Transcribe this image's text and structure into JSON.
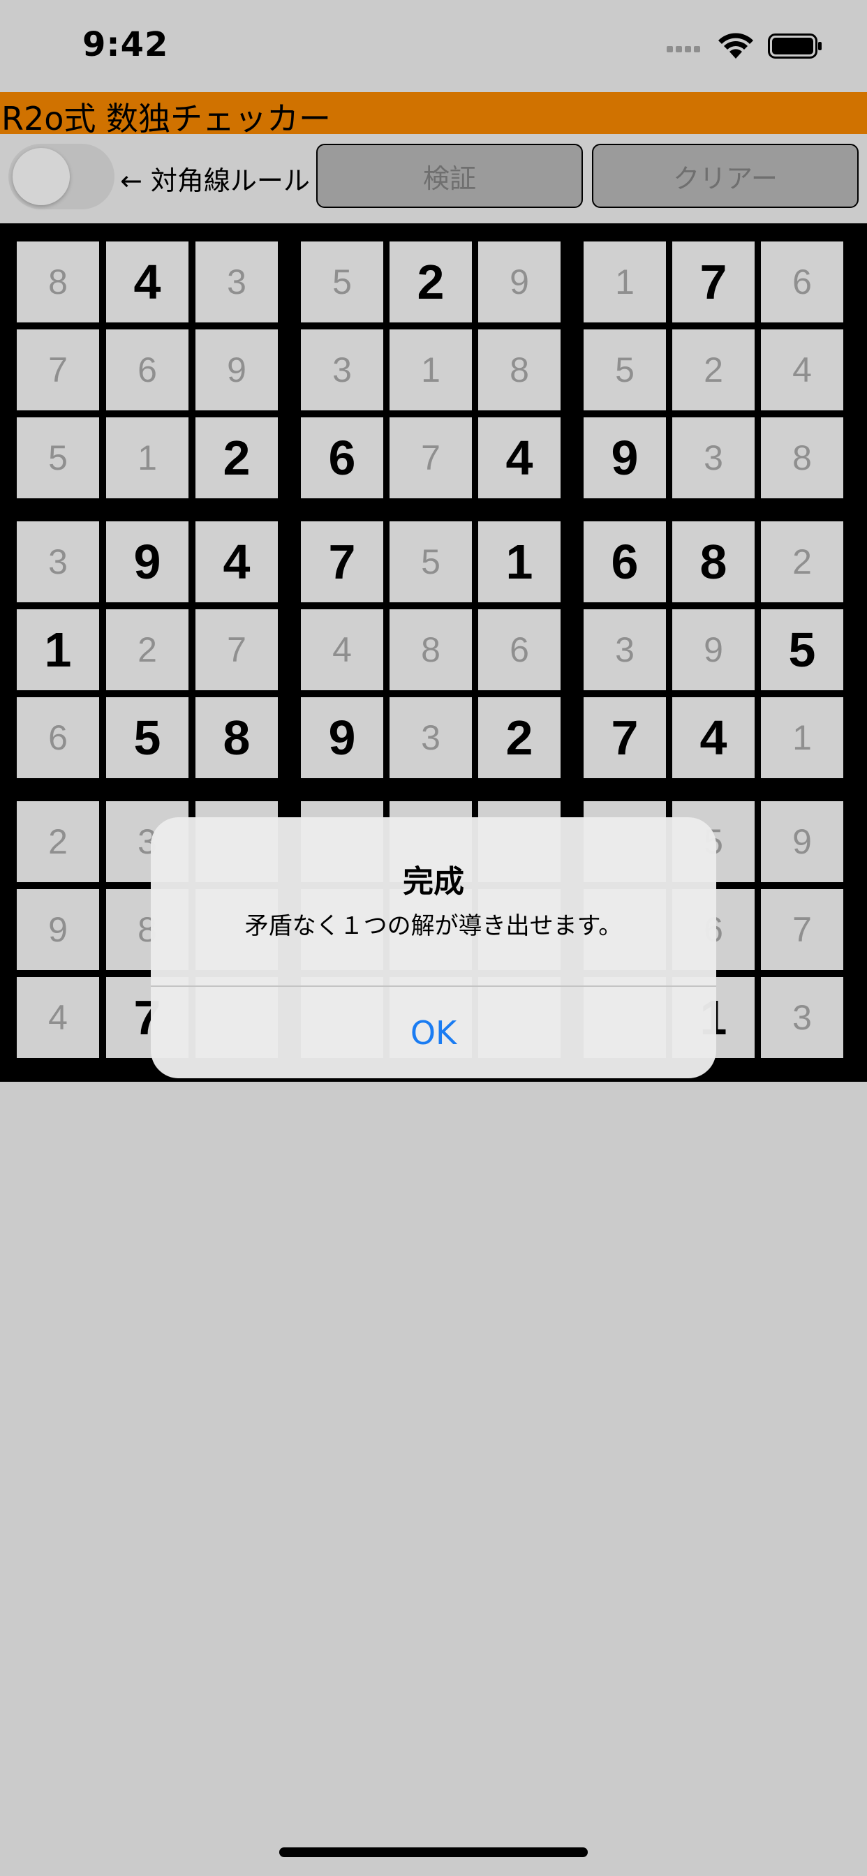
{
  "status": {
    "time": "9:42",
    "icons": [
      "cellular-signal-icon",
      "wifi-icon",
      "battery-icon"
    ]
  },
  "app": {
    "title": "R2o式 数独チェッカー",
    "title_bar_color": "#d07200"
  },
  "toolbar": {
    "diagonal_toggle_on": false,
    "diagonal_label": "← 対角線ルール",
    "verify_label": "検証",
    "clear_label": "クリアー"
  },
  "board": {
    "rows": [
      [
        {
          "v": "8",
          "given": false
        },
        {
          "v": "4",
          "given": true
        },
        {
          "v": "3",
          "given": false
        },
        {
          "v": "5",
          "given": false
        },
        {
          "v": "2",
          "given": true
        },
        {
          "v": "9",
          "given": false
        },
        {
          "v": "1",
          "given": false
        },
        {
          "v": "7",
          "given": true
        },
        {
          "v": "6",
          "given": false
        }
      ],
      [
        {
          "v": "7",
          "given": false
        },
        {
          "v": "6",
          "given": false
        },
        {
          "v": "9",
          "given": false
        },
        {
          "v": "3",
          "given": false
        },
        {
          "v": "1",
          "given": false
        },
        {
          "v": "8",
          "given": false
        },
        {
          "v": "5",
          "given": false
        },
        {
          "v": "2",
          "given": false
        },
        {
          "v": "4",
          "given": false
        }
      ],
      [
        {
          "v": "5",
          "given": false
        },
        {
          "v": "1",
          "given": false
        },
        {
          "v": "2",
          "given": true
        },
        {
          "v": "6",
          "given": true
        },
        {
          "v": "7",
          "given": false
        },
        {
          "v": "4",
          "given": true
        },
        {
          "v": "9",
          "given": true
        },
        {
          "v": "3",
          "given": false
        },
        {
          "v": "8",
          "given": false
        }
      ],
      [
        {
          "v": "3",
          "given": false
        },
        {
          "v": "9",
          "given": true
        },
        {
          "v": "4",
          "given": true
        },
        {
          "v": "7",
          "given": true
        },
        {
          "v": "5",
          "given": false
        },
        {
          "v": "1",
          "given": true
        },
        {
          "v": "6",
          "given": true
        },
        {
          "v": "8",
          "given": true
        },
        {
          "v": "2",
          "given": false
        }
      ],
      [
        {
          "v": "1",
          "given": true
        },
        {
          "v": "2",
          "given": false
        },
        {
          "v": "7",
          "given": false
        },
        {
          "v": "4",
          "given": false
        },
        {
          "v": "8",
          "given": false
        },
        {
          "v": "6",
          "given": false
        },
        {
          "v": "3",
          "given": false
        },
        {
          "v": "9",
          "given": false
        },
        {
          "v": "5",
          "given": true
        }
      ],
      [
        {
          "v": "6",
          "given": false
        },
        {
          "v": "5",
          "given": true
        },
        {
          "v": "8",
          "given": true
        },
        {
          "v": "9",
          "given": true
        },
        {
          "v": "3",
          "given": false
        },
        {
          "v": "2",
          "given": true
        },
        {
          "v": "7",
          "given": true
        },
        {
          "v": "4",
          "given": true
        },
        {
          "v": "1",
          "given": false
        }
      ],
      [
        {
          "v": "2",
          "given": false
        },
        {
          "v": "3",
          "given": false
        },
        {
          "v": "",
          "given": false
        },
        {
          "v": "",
          "given": false
        },
        {
          "v": "",
          "given": false
        },
        {
          "v": "",
          "given": false
        },
        {
          "v": "",
          "given": false
        },
        {
          "v": "5",
          "given": false
        },
        {
          "v": "9",
          "given": false
        }
      ],
      [
        {
          "v": "9",
          "given": false
        },
        {
          "v": "8",
          "given": false
        },
        {
          "v": "",
          "given": false
        },
        {
          "v": "",
          "given": false
        },
        {
          "v": "",
          "given": false
        },
        {
          "v": "",
          "given": false
        },
        {
          "v": "",
          "given": false
        },
        {
          "v": "6",
          "given": false
        },
        {
          "v": "7",
          "given": false
        }
      ],
      [
        {
          "v": "4",
          "given": false
        },
        {
          "v": "7",
          "given": true
        },
        {
          "v": "",
          "given": false
        },
        {
          "v": "",
          "given": false
        },
        {
          "v": "",
          "given": false
        },
        {
          "v": "",
          "given": false
        },
        {
          "v": "",
          "given": false
        },
        {
          "v": "1",
          "given": true
        },
        {
          "v": "3",
          "given": false
        }
      ]
    ]
  },
  "alert": {
    "title": "完成",
    "message": "矛盾なく１つの解が導き出せます。",
    "ok_label": "OK"
  }
}
